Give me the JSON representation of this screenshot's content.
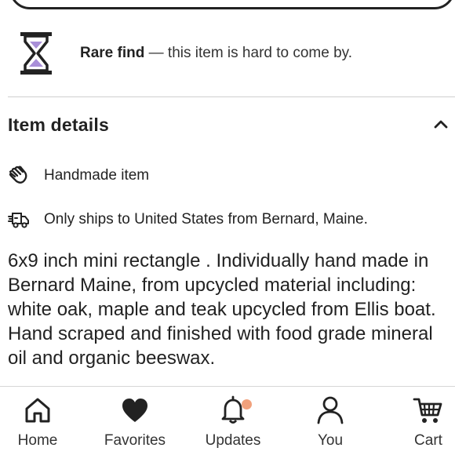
{
  "rare": {
    "bold": "Rare find",
    "rest": " — this item is hard to come by."
  },
  "details": {
    "title": "Item details",
    "rows": [
      {
        "icon": "handmade-hands-icon",
        "text": "Handmade item"
      },
      {
        "icon": "delivery-truck-icon",
        "text": "Only ships to United States from Bernard, Maine."
      }
    ],
    "description": "6x9 inch mini rectangle . Individually hand made in Bernard Maine, from upcycled material including:  white oak, maple and teak upcycled from Ellis boat. Hand scraped and finished with food grade mineral oil and organic beeswax."
  },
  "nav": {
    "items": [
      {
        "label": "Home",
        "icon": "home-icon"
      },
      {
        "label": "Favorites",
        "icon": "heart-icon"
      },
      {
        "label": "Updates",
        "icon": "bell-icon",
        "badge": true
      },
      {
        "label": "You",
        "icon": "person-icon"
      },
      {
        "label": "Cart",
        "icon": "cart-icon"
      }
    ]
  },
  "colors": {
    "accent_purple": "#a98fd8",
    "badge": "#f1a17c",
    "text": "#222222"
  }
}
